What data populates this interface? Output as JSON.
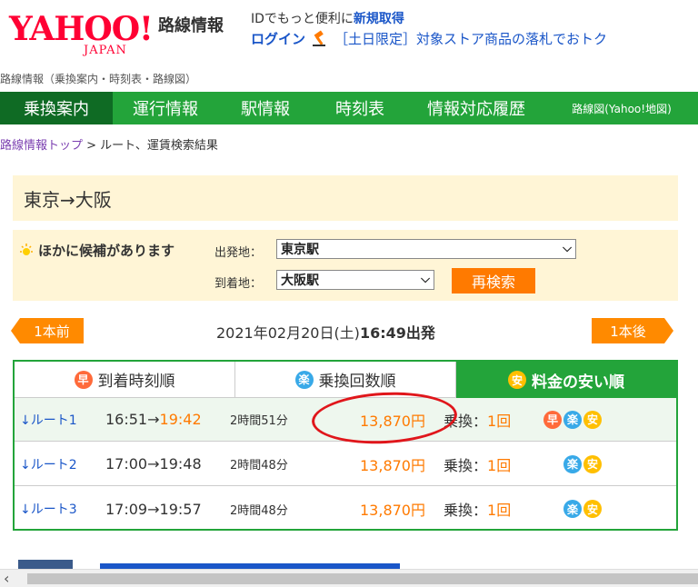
{
  "header": {
    "logo": "YAHOO!",
    "logo_sub": "JAPAN",
    "site_title": "路線情報",
    "line1_prefix": "IDでもっと便利に",
    "line1_link": "新規取得",
    "login": "ログイン",
    "promo": "［土日限定］対象ストア商品の落札でおトク"
  },
  "top_crumb": "路線情報（乗換案内・時刻表・路線図）",
  "nav": {
    "items": [
      "乗換案内",
      "運行情報",
      "駅情報",
      "時刻表",
      "情報対応履歴",
      "路線図(Yahoo!地図)"
    ]
  },
  "breadcrumb": {
    "link": "路線情報トップ",
    "current": " > ルート、運賃検索結果"
  },
  "route_title": "東京→大阪",
  "alternatives": {
    "title": "ほかに候補があります",
    "from_label": "出発地：",
    "from_value": "東京駅",
    "to_label": "到着地：",
    "to_value": "大阪駅",
    "research": "再検索"
  },
  "pager": {
    "prev": "1本前",
    "next": "1本後",
    "depart_date": "2021年02月20日(土)",
    "depart_time": "16:49出発"
  },
  "tabs": [
    {
      "badge": "早",
      "label": "到着時刻順",
      "active": false
    },
    {
      "badge": "楽",
      "label": "乗換回数順",
      "active": false
    },
    {
      "badge": "安",
      "label": "料金の安い順",
      "active": true
    }
  ],
  "routes": [
    {
      "link": "↓ルート1",
      "dep": "16:51→",
      "arr": "19:42",
      "duration": "2時間51分",
      "fare": "13,870円",
      "transfer_label": "乗換：",
      "transfer_count": "1回",
      "badges": [
        "早",
        "楽",
        "安"
      ]
    },
    {
      "link": "↓ルート2",
      "dep": "17:00→19:48",
      "arr": "",
      "duration": "2時間48分",
      "fare": "13,870円",
      "transfer_label": "乗換：",
      "transfer_count": "1回",
      "badges": [
        "楽",
        "安"
      ]
    },
    {
      "link": "↓ルート3",
      "dep": "17:09→19:57",
      "arr": "",
      "duration": "2時間48分",
      "fare": "13,870円",
      "transfer_label": "乗換：",
      "transfer_count": "1回",
      "badges": [
        "楽",
        "安"
      ]
    }
  ],
  "colors": {
    "nav_green": "#23a43a",
    "nav_active": "#0f6b24",
    "accent_orange": "#ff7a00",
    "annotation_red": "#e0161b"
  }
}
